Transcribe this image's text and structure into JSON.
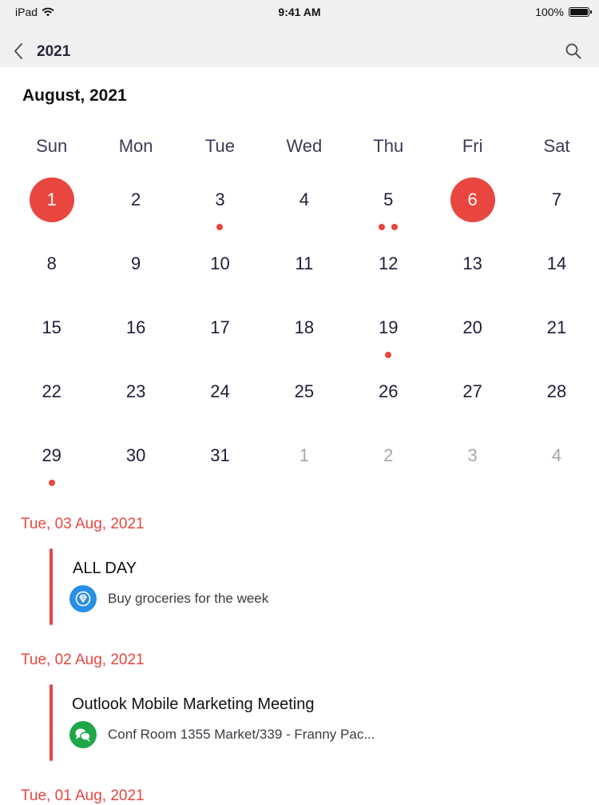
{
  "status_bar": {
    "device": "iPad",
    "time": "9:41 AM",
    "battery": "100%"
  },
  "nav": {
    "title": "2021"
  },
  "calendar": {
    "month_title": "August, 2021",
    "weekdays": [
      "Sun",
      "Mon",
      "Tue",
      "Wed",
      "Thu",
      "Fri",
      "Sat"
    ],
    "weeks": [
      [
        "1",
        "2",
        "3",
        "4",
        "5",
        "6",
        "7"
      ],
      [
        "8",
        "9",
        "10",
        "11",
        "12",
        "13",
        "14"
      ],
      [
        "15",
        "16",
        "17",
        "18",
        "19",
        "20",
        "21"
      ],
      [
        "22",
        "23",
        "24",
        "25",
        "26",
        "27",
        "28"
      ],
      [
        "29",
        "30",
        "31",
        "1",
        "2",
        "3",
        "4"
      ]
    ]
  },
  "agenda": [
    {
      "date": "Tue, 03 Aug, 2021",
      "title": "ALL DAY",
      "detail": "Buy groceries for the week",
      "icon": "diamond-badge-icon",
      "icon_color": "#2b8fe6"
    },
    {
      "date": "Tue, 02 Aug, 2021",
      "title": "Outlook Mobile Marketing Meeting",
      "detail": "Conf Room 1355 Market/339 - Franny Pac...",
      "icon": "chat-bubbles-icon",
      "icon_color": "#1fa64a"
    },
    {
      "date": "Tue, 01 Aug, 2021"
    }
  ],
  "colors": {
    "accent": "#e8463f",
    "nav_background": "#f0f0f0"
  }
}
